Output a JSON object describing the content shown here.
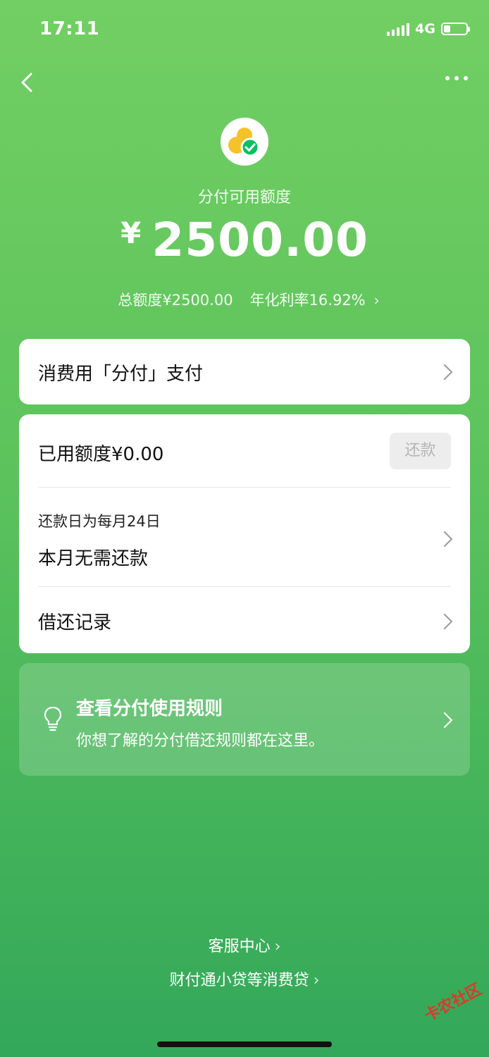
{
  "status_bar": {
    "time": "17:11",
    "network": "4G",
    "battery_level": 0.3
  },
  "nav": {
    "back_icon": "chevron-left-icon",
    "more_icon": "more-dots-icon"
  },
  "header": {
    "logo_icon": "fenfu-logo-icon",
    "available_label": "分付可用额度",
    "currency": "¥",
    "amount": "2500.00",
    "total_limit": "总额度¥2500.00",
    "annual_rate": "年化利率16.92%"
  },
  "pay_card": {
    "label": "消费用「分付」支付"
  },
  "usage_card": {
    "used_limit": "已用额度¥0.00",
    "repay_button": "还款",
    "repay_day": "还款日为每月24日",
    "repay_status": "本月无需还款",
    "records": "借还记录"
  },
  "rules_card": {
    "icon": "lightbulb-icon",
    "title": "查看分付使用规则",
    "subtitle": "你想了解的分付借还规则都在这里。"
  },
  "footer": {
    "service_center": "客服中心",
    "loan_note": "财付通小贷等消费贷"
  },
  "watermark": "卡农社区",
  "colors": {
    "brand_green": "#5cc35c",
    "card_bg": "#ffffff",
    "logo_yellow": "#f6c22a",
    "logo_green": "#07c160"
  }
}
